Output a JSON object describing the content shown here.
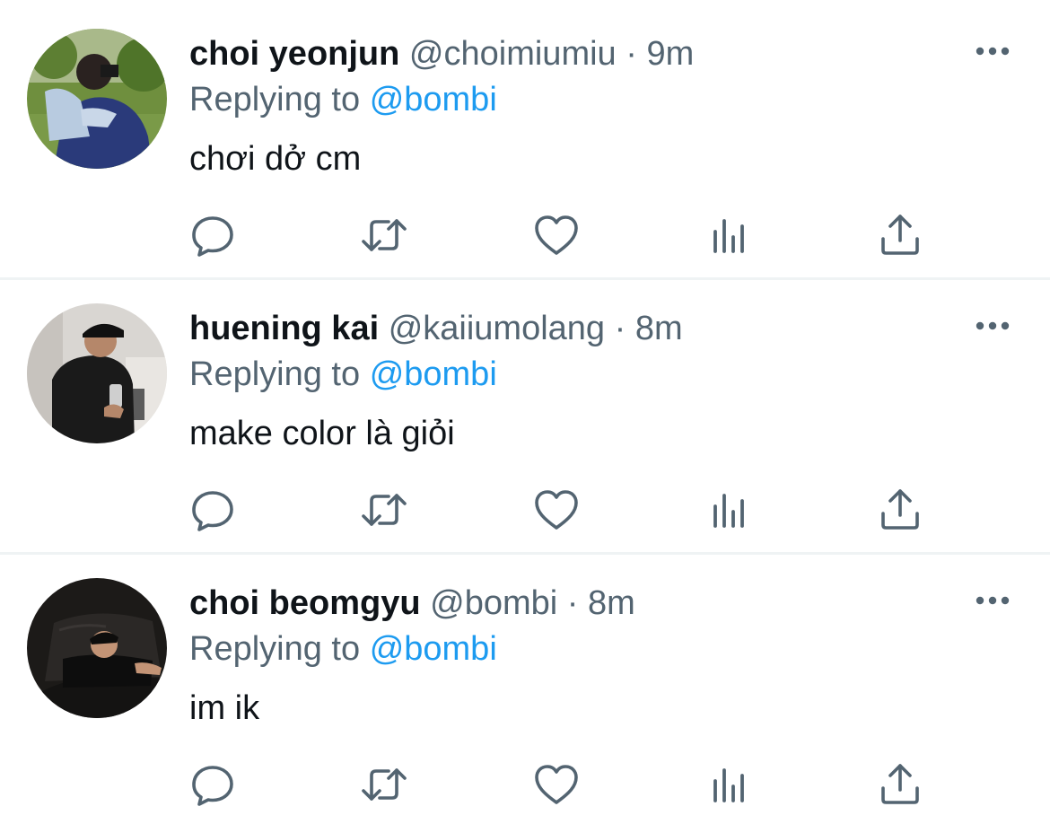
{
  "colors": {
    "text_primary": "#0f1419",
    "text_secondary": "#536471",
    "link": "#1d9bf0",
    "icon": "#536471",
    "divider": "#eff3f4"
  },
  "reply_prefix": "Replying to",
  "separator": "·",
  "tweets": [
    {
      "name": "choi yeonjun",
      "handle": "@choimiumiu",
      "time": "9m",
      "reply_to": "@bombi",
      "text": "chơi dở cm",
      "avatar": "avatar-photo-man-with-camera-outdoors"
    },
    {
      "name": "huening kai",
      "handle": "@kaiiumolang",
      "time": "8m",
      "reply_to": "@bombi",
      "text": "make color là giỏi",
      "avatar": "avatar-photo-mirror-selfie"
    },
    {
      "name": "choi beomgyu",
      "handle": "@bombi",
      "time": "8m",
      "reply_to": "@bombi",
      "text": "im ik",
      "avatar": "avatar-photo-man-on-leather-sofa"
    }
  ],
  "icons": {
    "more": "more-horizontal-icon",
    "reply": "reply-bubble-icon",
    "retweet": "retweet-icon",
    "like": "heart-icon",
    "views": "analytics-bars-icon",
    "share": "share-upload-icon"
  }
}
